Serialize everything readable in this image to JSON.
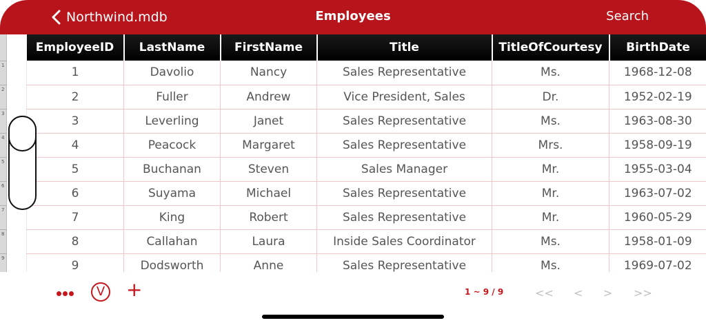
{
  "nav": {
    "back_label": "Northwind.mdb",
    "title": "Employees",
    "search_label": "Search"
  },
  "gutter": [
    "1",
    "2",
    "3",
    "4",
    "5",
    "6",
    "7",
    "8",
    "9"
  ],
  "table": {
    "columns": [
      "EmployeeID",
      "LastName",
      "FirstName",
      "Title",
      "TitleOfCourtesy",
      "BirthDate"
    ],
    "rows": [
      [
        "1",
        "Davolio",
        "Nancy",
        "Sales Representative",
        "Ms.",
        "1968-12-08"
      ],
      [
        "2",
        "Fuller",
        "Andrew",
        "Vice President, Sales",
        "Dr.",
        "1952-02-19"
      ],
      [
        "3",
        "Leverling",
        "Janet",
        "Sales Representative",
        "Ms.",
        "1963-08-30"
      ],
      [
        "4",
        "Peacock",
        "Margaret",
        "Sales Representative",
        "Mrs.",
        "1958-09-19"
      ],
      [
        "5",
        "Buchanan",
        "Steven",
        "Sales Manager",
        "Mr.",
        "1955-03-04"
      ],
      [
        "6",
        "Suyama",
        "Michael",
        "Sales Representative",
        "Mr.",
        "1963-07-02"
      ],
      [
        "7",
        "King",
        "Robert",
        "Sales Representative",
        "Mr.",
        "1960-05-29"
      ],
      [
        "8",
        "Callahan",
        "Laura",
        "Inside Sales Coordinator",
        "Ms.",
        "1958-01-09"
      ],
      [
        "9",
        "Dodsworth",
        "Anne",
        "Sales Representative",
        "Ms.",
        "1969-07-02"
      ]
    ]
  },
  "toolbar": {
    "v_label": "V",
    "plus_label": "+",
    "page_info": "1 ~ 9 / 9",
    "first_label": "<<",
    "prev_label": "<",
    "next_label": ">",
    "last_label": ">>"
  },
  "colors": {
    "accent": "#b8141b",
    "header_bg": "#000000",
    "grid_line": "#f0c6c8"
  }
}
